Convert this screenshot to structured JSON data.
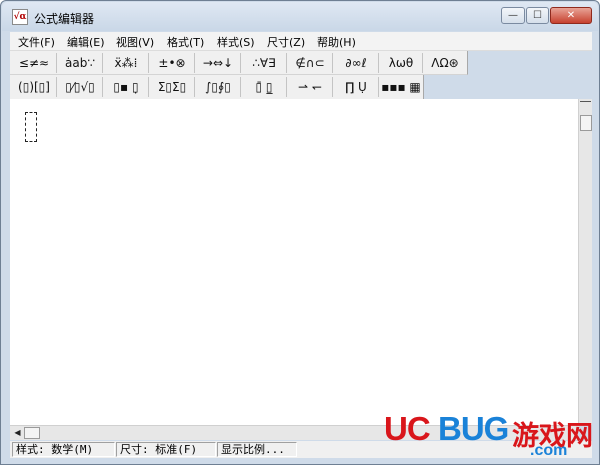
{
  "window": {
    "title": "公式编辑器",
    "icon_label": "√α",
    "controls": {
      "minimize": "—",
      "maximize": "☐",
      "close": "✕"
    }
  },
  "menu": [
    {
      "label": "文件(F)"
    },
    {
      "label": "编辑(E)"
    },
    {
      "label": "视图(V)"
    },
    {
      "label": "格式(T)"
    },
    {
      "label": "样式(S)"
    },
    {
      "label": "尺寸(Z)"
    },
    {
      "label": "帮助(H)"
    }
  ],
  "toolbar": {
    "row1": [
      {
        "name": "relations-palette",
        "glyph": "≤≠≈"
      },
      {
        "name": "spaces-ellipses-palette",
        "glyph": "ȧab∵"
      },
      {
        "name": "embellishments-palette",
        "glyph": "ẍ⁂⁞"
      },
      {
        "name": "operators-palette",
        "glyph": "±•⊗"
      },
      {
        "name": "arrows-palette",
        "glyph": "→⇔↓"
      },
      {
        "name": "logic-palette",
        "glyph": "∴∀∃"
      },
      {
        "name": "set-theory-palette",
        "glyph": "∉∩⊂"
      },
      {
        "name": "misc-symbols-palette",
        "glyph": "∂∞ℓ"
      },
      {
        "name": "greek-lowercase-palette",
        "glyph": "λωθ"
      },
      {
        "name": "greek-uppercase-palette",
        "glyph": "ΛΩ⊛"
      }
    ],
    "row2": [
      {
        "name": "fences-templates",
        "glyph": "(▯)[▯]"
      },
      {
        "name": "fraction-radical-templates",
        "glyph": "▯⁄▯√▯"
      },
      {
        "name": "subscript-superscript-templates",
        "glyph": "▯▪ ▯̣"
      },
      {
        "name": "summation-templates",
        "glyph": "Σ▯Σ▯"
      },
      {
        "name": "integral-templates",
        "glyph": "∫▯∮▯"
      },
      {
        "name": "underbar-overbar-templates",
        "glyph": "▯̄ ▯̲"
      },
      {
        "name": "labeled-arrow-templates",
        "glyph": "⇀ ↽"
      },
      {
        "name": "products-set-templates",
        "glyph": "∏̣ Ụ"
      },
      {
        "name": "matrix-templates",
        "glyph": "▪▪▪ ▦"
      }
    ]
  },
  "status": {
    "style": "样式: 数学(M)",
    "size": "尺寸: 标准(F)",
    "zoom": "显示比例..."
  },
  "watermark": {
    "brand_red": "UC",
    "brand_blue": "BUG",
    "brand_cn": "游戏网",
    "domain": ".com",
    "red_color": "#d9161b",
    "blue_color": "#1a82d8"
  }
}
